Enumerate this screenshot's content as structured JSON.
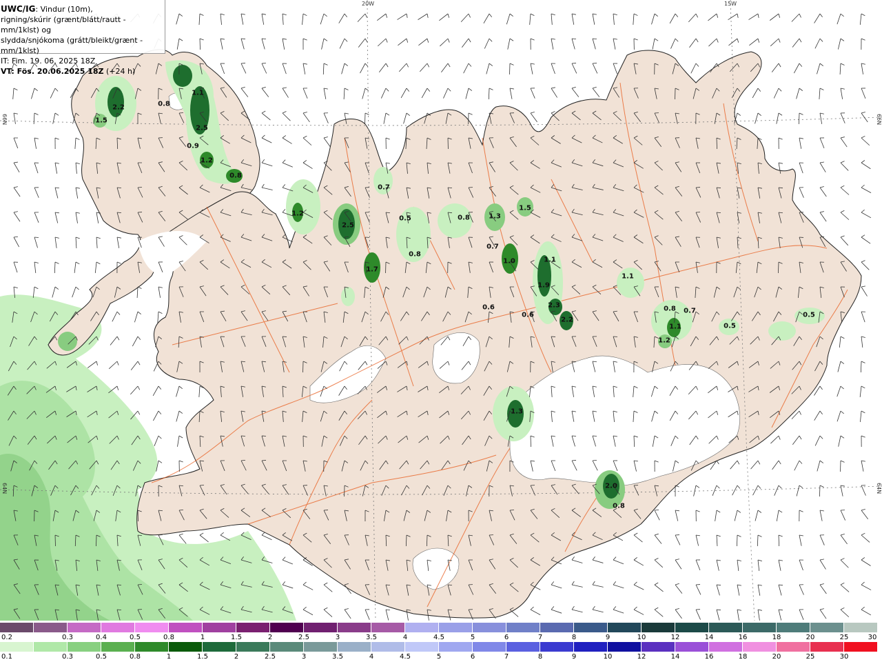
{
  "header": {
    "title": "UWC/IG",
    "line1": ": Vindur (10m),",
    "line2": "rigning/skúrir (grænt/blátt/rautt - mm/1klst) og",
    "line3": "slydda/snjókoma (grátt/bleikt/grænt - mm/1klst)",
    "it": "IT: Fim. 19. 06. 2025 18Z",
    "vt_label": "VT: Fös. 20.06.2025 18Z",
    "vt_offset": " (+24 h)"
  },
  "axes": {
    "lon_20w": "20W",
    "lon_15w": "15W",
    "lat_66n_left": "66N",
    "lat_66n_right": "66N",
    "lat_64n_left": "64N",
    "lat_64n_right": "64N"
  },
  "precip_labels": [
    "2.2",
    "1.5",
    "0.8",
    "1.1",
    "2.5",
    "0.9",
    "1.2",
    "0.8",
    "0.7",
    "1.2",
    "2.5",
    "1.7",
    "0.5",
    "0.8",
    "0.8",
    "1.3",
    "1.5",
    "0.7",
    "1.0",
    "1.1",
    "1.9",
    "2.3",
    "2.2",
    "0.6",
    "0.6",
    "1.1",
    "0.8",
    "0.7",
    "1.1",
    "1.2",
    "0.5",
    "0.5",
    "1.3",
    "2.0",
    "0.8"
  ],
  "legend_snow": {
    "labels": [
      "0.2",
      "0.3",
      "0.4",
      "0.5",
      "0.8",
      "1",
      "1.5",
      "2",
      "2.5",
      "3",
      "3.5",
      "4",
      "4.5",
      "5",
      "6",
      "7",
      "8",
      "9",
      "10",
      "12",
      "14",
      "16",
      "18",
      "20",
      "25",
      "30"
    ],
    "colors": [
      "#6b4a6b",
      "#8a5a8a",
      "#c56ac5",
      "#e07ae0",
      "#f08cf0",
      "#c050c0",
      "#a040a0",
      "#7a2070",
      "#500050",
      "#702070",
      "#8a3c8a",
      "#a65aa6",
      "#b0b0f0",
      "#9aa0e8",
      "#8890dc",
      "#7080c8",
      "#5a6ab0",
      "#3a5a8a",
      "#22485a",
      "#1a3a3a",
      "#1c4a48",
      "#2c5a58",
      "#3c6a68",
      "#4e7c7a",
      "#6c908e",
      "#b8c8c0"
    ]
  },
  "legend_rain": {
    "labels": [
      "0.1",
      "0.3",
      "0.5",
      "0.8",
      "1",
      "1.5",
      "2",
      "2.5",
      "3",
      "3.5",
      "4",
      "4.5",
      "5",
      "6",
      "7",
      "8",
      "9",
      "10",
      "12",
      "14",
      "16",
      "18",
      "20",
      "25",
      "30"
    ],
    "colors": [
      "#d8f5d0",
      "#b0e8a8",
      "#88d080",
      "#5ab050",
      "#2e8a2a",
      "#0a5a0a",
      "#1e6a3a",
      "#3a7a5a",
      "#5a8a7a",
      "#7a9a9a",
      "#9ab0c8",
      "#b0bce8",
      "#c0c8f8",
      "#a0a8f0",
      "#8088e8",
      "#5a60e0",
      "#3a3ad0",
      "#2020c0",
      "#1010a0",
      "#5a30c0",
      "#9a50d8",
      "#d070e0",
      "#f090e0",
      "#f070a0",
      "#e83050",
      "#f01020"
    ]
  },
  "colors": {
    "land": "#f1e2d6",
    "ice": "#ffffff",
    "roads": "#e85a1a",
    "rivers": "#e07a4a",
    "light_green": "#c8f0c0",
    "mid_green": "#88cc80",
    "dark_green": "#1e6e2e"
  }
}
